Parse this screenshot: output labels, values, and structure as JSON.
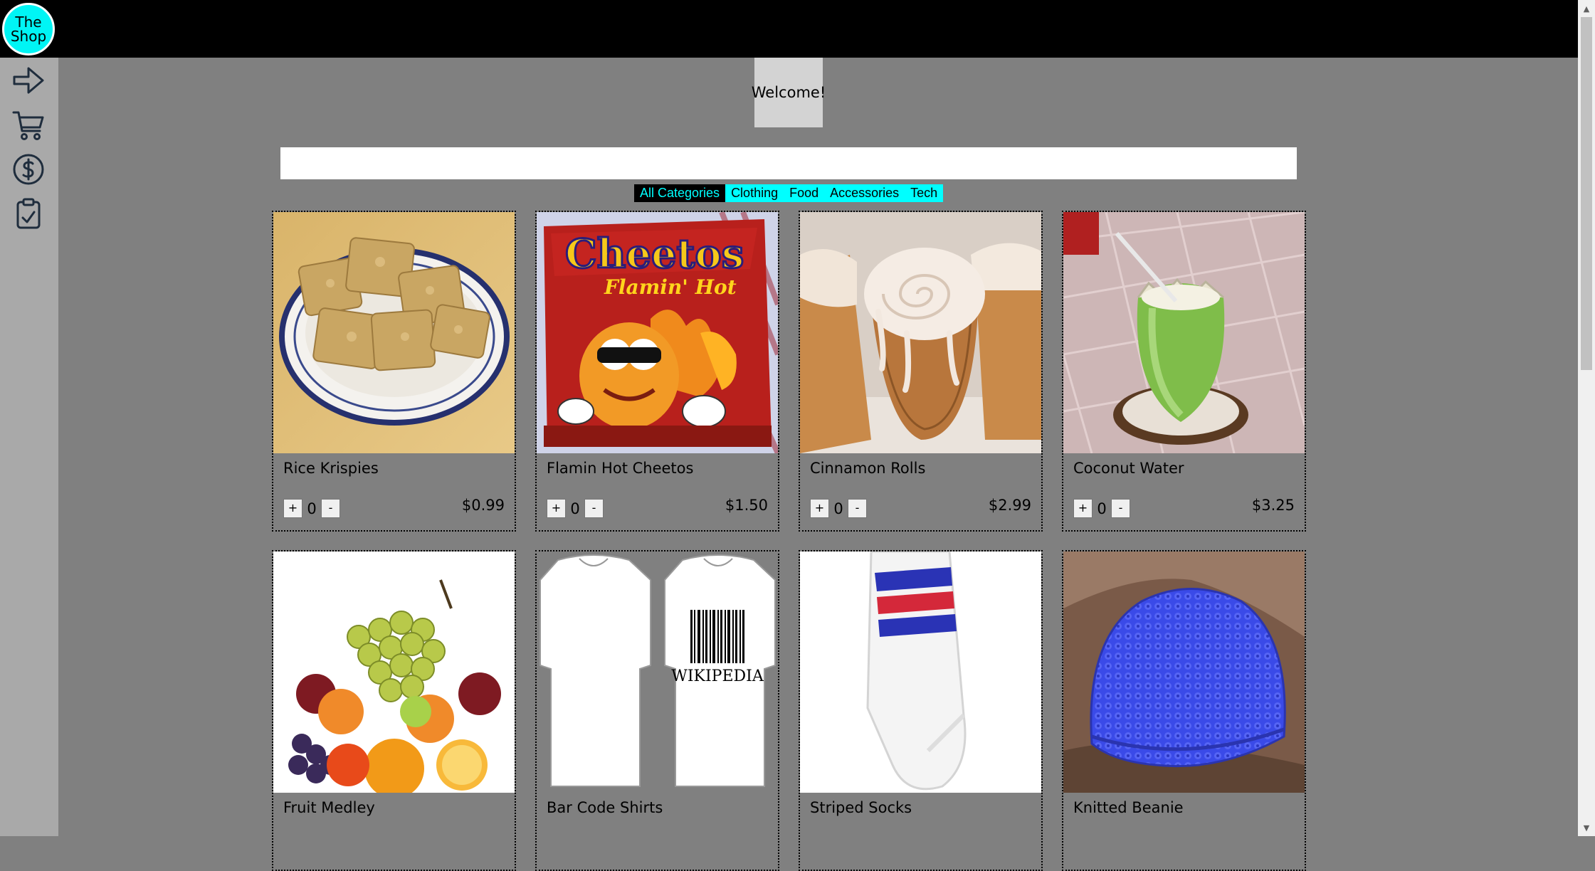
{
  "header": {
    "logo_line1": "The",
    "logo_line2": "Shop"
  },
  "sidebar": {
    "items": [
      {
        "icon": "arrow-right-icon",
        "label": "login"
      },
      {
        "icon": "cart-icon",
        "label": "cart"
      },
      {
        "icon": "dollar-icon",
        "label": "checkout"
      },
      {
        "icon": "clipboard-check-icon",
        "label": "orders"
      }
    ]
  },
  "welcome": "Welcome!",
  "search": {
    "value": "",
    "placeholder": ""
  },
  "categories": [
    {
      "label": "All Categories",
      "active": true
    },
    {
      "label": "Clothing",
      "active": false
    },
    {
      "label": "Food",
      "active": false
    },
    {
      "label": "Accessories",
      "active": false
    },
    {
      "label": "Tech",
      "active": false
    }
  ],
  "products": [
    {
      "name": "Rice Krispies",
      "qty": "0",
      "price": "$0.99",
      "plus": "+",
      "minus": "-"
    },
    {
      "name": "Flamin Hot Cheetos",
      "qty": "0",
      "price": "$1.50",
      "plus": "+",
      "minus": "-"
    },
    {
      "name": "Cinnamon Rolls",
      "qty": "0",
      "price": "$2.99",
      "plus": "+",
      "minus": "-"
    },
    {
      "name": "Coconut Water",
      "qty": "0",
      "price": "$3.25",
      "plus": "+",
      "minus": "-"
    },
    {
      "name": "Fruit Medley"
    },
    {
      "name": "Bar Code Shirts"
    },
    {
      "name": "Striped Socks"
    },
    {
      "name": "Knitted Beanie"
    }
  ],
  "image_text": {
    "cheetos_brand": "Cheetos",
    "cheetos_flavor": "Flamin' Hot",
    "shirt_print": "WIKIPEDIA"
  },
  "colors": {
    "topbar": "#000000",
    "logo": "#00f5f5",
    "sidebar": "#a9a9a9",
    "background": "#808080",
    "category_bar": "#00ffff",
    "category_active_bg": "#000000"
  }
}
